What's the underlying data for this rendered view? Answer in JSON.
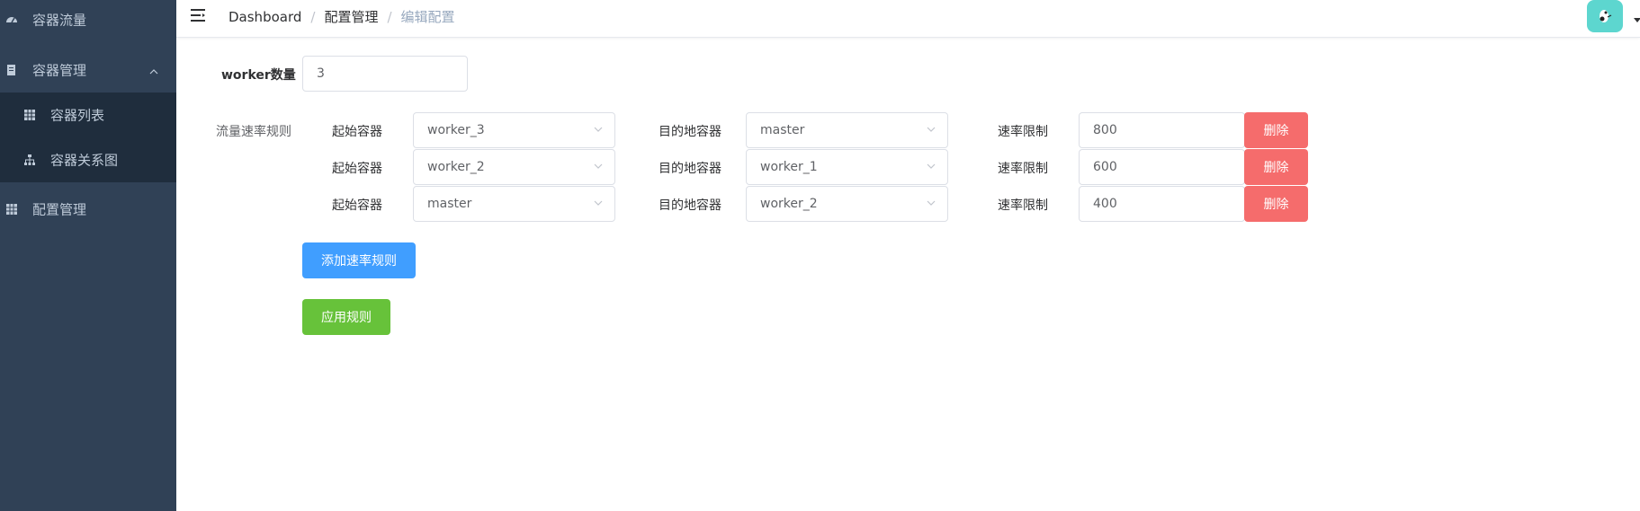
{
  "sidebar": {
    "items": [
      {
        "label": "容器流量",
        "icon": "dashboard-icon"
      },
      {
        "label": "容器管理",
        "icon": "document-icon"
      },
      {
        "label": "配置管理",
        "icon": "table-icon"
      }
    ],
    "submenu": [
      {
        "label": "容器列表",
        "icon": "table-icon"
      },
      {
        "label": "容器关系图",
        "icon": "tree-icon"
      }
    ]
  },
  "breadcrumb": {
    "home": "Dashboard",
    "parent": "配置管理",
    "current": "编辑配置",
    "separator": "/"
  },
  "form": {
    "worker_label": "worker数量",
    "worker_value": "3",
    "rules_label": "流量速率规则",
    "source_label": "起始容器",
    "target_label": "目的地容器",
    "rate_label": "速率限制",
    "delete_label": "删除",
    "rules": [
      {
        "source": "worker_3",
        "target": "master",
        "rate": "800"
      },
      {
        "source": "worker_2",
        "target": "worker_1",
        "rate": "600"
      },
      {
        "source": "master",
        "target": "worker_2",
        "rate": "400"
      }
    ],
    "add_rule_label": "添加速率规则",
    "apply_label": "应用规则"
  },
  "colors": {
    "sidebar_bg": "#304156",
    "submenu_bg": "#1f2d3d",
    "primary": "#409eff",
    "success": "#67c23a",
    "danger": "#f56c6c"
  }
}
